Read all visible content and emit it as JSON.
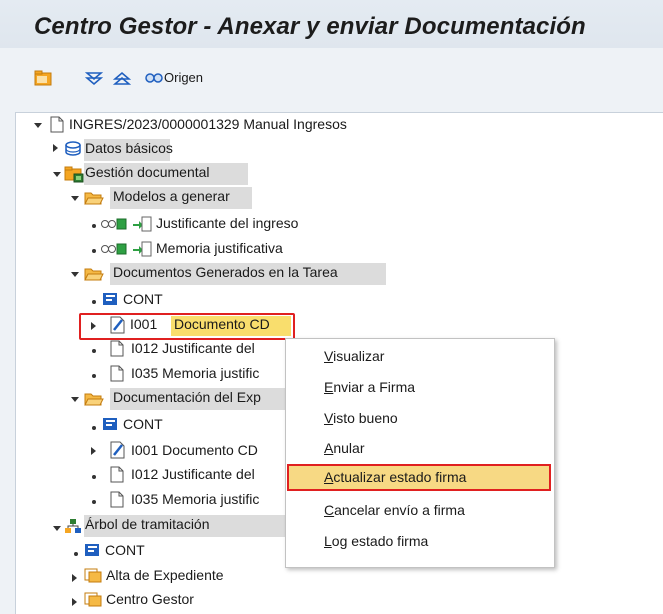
{
  "window": {
    "title": "Centro Gestor - Anexar y enviar Documentación"
  },
  "toolbar": {
    "buttons": [
      {
        "icon": "new-folder-icon",
        "tooltip": ""
      },
      {
        "icon": "expand-all-icon",
        "tooltip": ""
      },
      {
        "icon": "collapse-all-icon",
        "tooltip": ""
      }
    ],
    "origen_label": "Origen"
  },
  "tree": {
    "root": "INGRES/2023/0000001329 Manual Ingresos",
    "datos_basicos": "Datos básicos",
    "gestion_documental": "Gestión documental",
    "modelos": "Modelos a generar",
    "modelo_1": "Justificante del ingreso",
    "modelo_2": "Memoria justificativa",
    "docs_generados": "Documentos Generados en la Tarea",
    "gen_cont": "CONT",
    "gen_i001_code": "I001",
    "gen_i001_name": "Documento CD",
    "gen_i012": "I012 Justificante del",
    "gen_i035": "I035 Memoria justific",
    "doc_expediente": "Documentación del Exp",
    "exp_cont": "CONT",
    "exp_i001": "I001 Documento CD",
    "exp_i012": "I012 Justificante del",
    "exp_i035": "I035 Memoria justific",
    "arbol": "Árbol de tramitación",
    "arbol_cont": "CONT",
    "alta": "Alta de Expediente",
    "centro": "Centro Gestor"
  },
  "context_menu": {
    "items": [
      "Visualizar",
      "Enviar a Firma",
      "Visto bueno",
      "Anular",
      "Actualizar estado firma",
      "Cancelar envío a firma",
      "Log estado firma"
    ],
    "highlighted_index": 4
  },
  "colors": {
    "selection_yellow": "#f9de6d",
    "highlight_red": "#e02020",
    "folder_orange": "#f5a623",
    "sap_blue": "#1f5fbf"
  }
}
